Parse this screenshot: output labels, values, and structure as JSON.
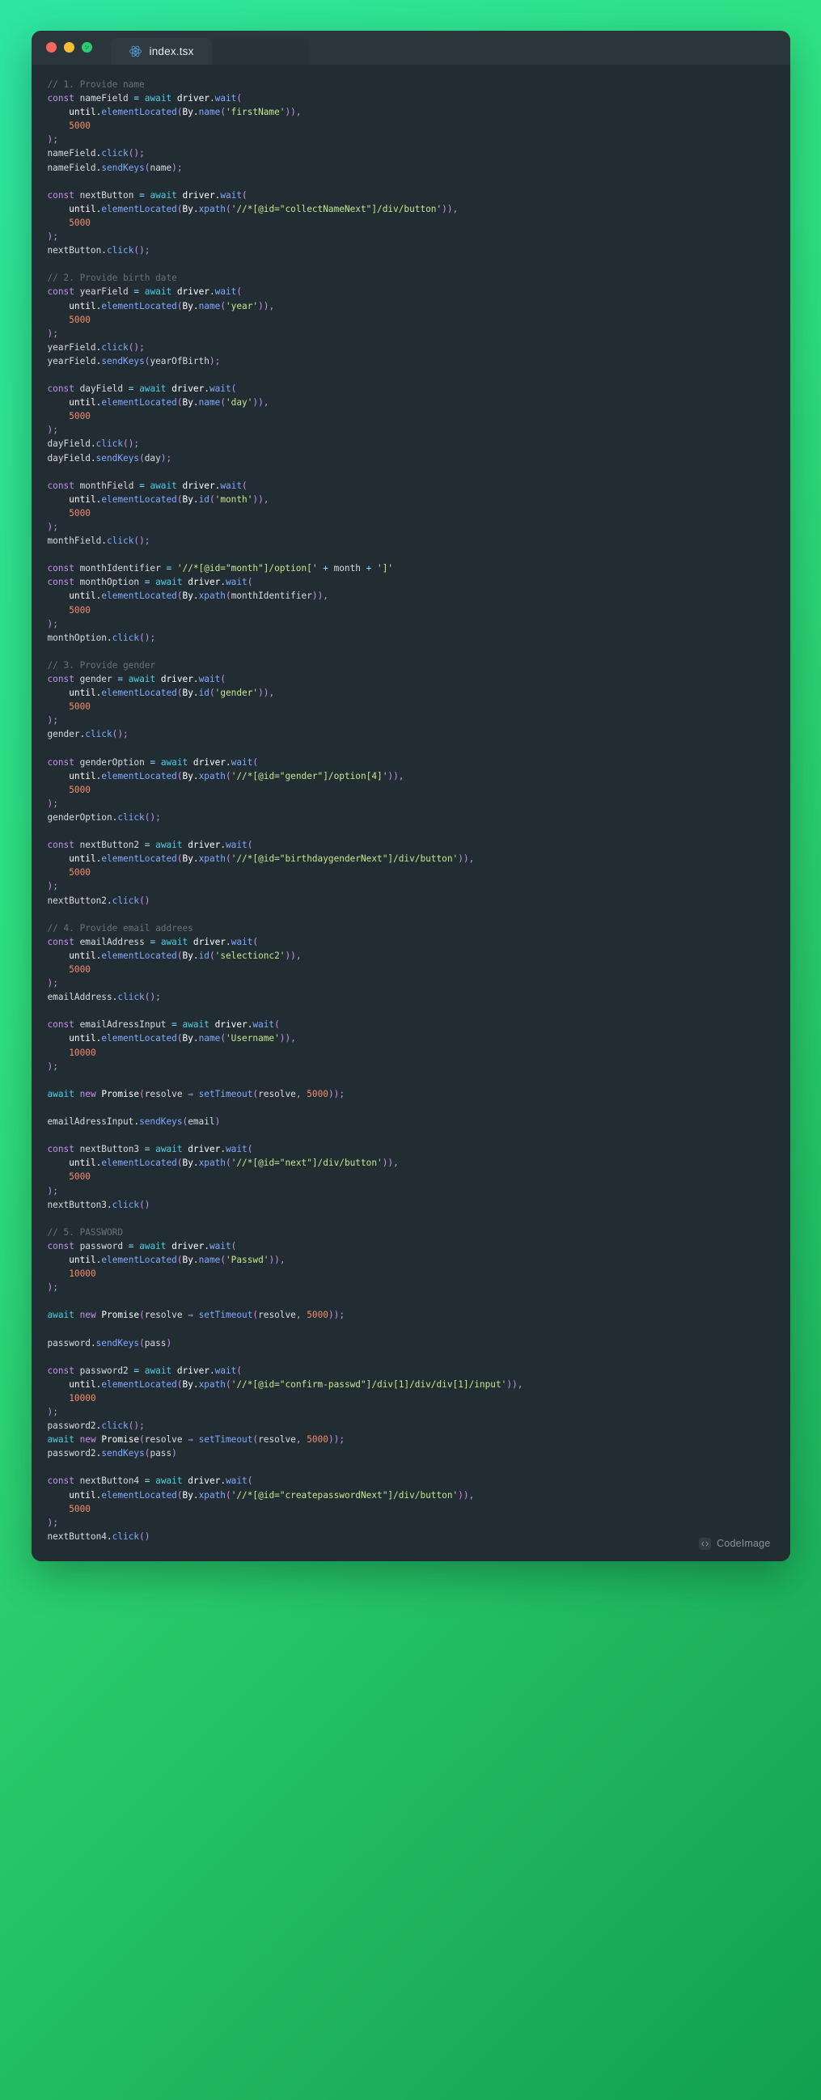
{
  "window": {
    "traffic_lights": [
      {
        "name": "close-button",
        "color": "#f9655f"
      },
      {
        "name": "minimize-button",
        "color": "#f7bd33"
      },
      {
        "name": "maximize-button",
        "color": "#2ecc71"
      }
    ],
    "tab": {
      "icon": "react-icon",
      "label": "index.tsx"
    }
  },
  "watermark": {
    "icon": "codeimage-logo-icon",
    "label": "CodeImage"
  },
  "editor": {
    "language": "typescript",
    "theme_background": "#222c33",
    "colors": {
      "comment": "#67737a",
      "keyword": "#c792ea",
      "await": "#4dd0e1",
      "function": "#82aaff",
      "string": "#c3e88d",
      "number": "#f78c6c",
      "punctuation": "#c792ea",
      "operator": "#89ddff",
      "plain": "#eceff4",
      "background": "#222c33",
      "titlebar": "#2b353c",
      "tab_active": "#2f3a42",
      "gradient_start": "#2ee6a0",
      "gradient_end": "#12a04f"
    },
    "code": "// 1. Provide name\nconst nameField = await driver.wait(\n    until.elementLocated(By.name('firstName')),\n    5000\n);\nnameField.click();\nnameField.sendKeys(name);\n\nconst nextButton = await driver.wait(\n    until.elementLocated(By.xpath('//*[@id=\"collectNameNext\"]/div/button')),\n    5000\n);\nnextButton.click();\n\n// 2. Provide birth date\nconst yearField = await driver.wait(\n    until.elementLocated(By.name('year')),\n    5000\n);\nyearField.click();\nyearField.sendKeys(yearOfBirth);\n\nconst dayField = await driver.wait(\n    until.elementLocated(By.name('day')),\n    5000\n);\ndayField.click();\ndayField.sendKeys(day);\n\nconst monthField = await driver.wait(\n    until.elementLocated(By.id('month')),\n    5000\n);\nmonthField.click();\n\nconst monthIdentifier = '//*[@id=\"month\"]/option[' + month + ']'\nconst monthOption = await driver.wait(\n    until.elementLocated(By.xpath(monthIdentifier)),\n    5000\n);\nmonthOption.click();\n\n// 3. Provide gender\nconst gender = await driver.wait(\n    until.elementLocated(By.id('gender')),\n    5000\n);\ngender.click();\n\nconst genderOption = await driver.wait(\n    until.elementLocated(By.xpath('//*[@id=\"gender\"]/option[4]')),\n    5000\n);\ngenderOption.click();\n\nconst nextButton2 = await driver.wait(\n    until.elementLocated(By.xpath('//*[@id=\"birthdaygenderNext\"]/div/button')),\n    5000\n);\nnextButton2.click()\n\n// 4. Provide email addrees\nconst emailAddress = await driver.wait(\n    until.elementLocated(By.id('selectionc2')),\n    5000\n);\nemailAddress.click();\n\nconst emailAdressInput = await driver.wait(\n    until.elementLocated(By.name('Username')),\n    10000\n);\n\nawait new Promise(resolve => setTimeout(resolve, 5000));\n\nemailAdressInput.sendKeys(email)\n\nconst nextButton3 = await driver.wait(\n    until.elementLocated(By.xpath('//*[@id=\"next\"]/div/button')),\n    5000\n);\nnextButton3.click()\n\n// 5. PASSWORD\nconst password = await driver.wait(\n    until.elementLocated(By.name('Passwd')),\n    10000\n);\n\nawait new Promise(resolve => setTimeout(resolve, 5000));\n\npassword.sendKeys(pass)\n\nconst password2 = await driver.wait(\n    until.elementLocated(By.xpath('//*[@id=\"confirm-passwd\"]/div[1]/div/div[1]/input')),\n    10000\n);\npassword2.click();\nawait new Promise(resolve => setTimeout(resolve, 5000));\npassword2.sendKeys(pass)\n\nconst nextButton4 = await driver.wait(\n    until.elementLocated(By.xpath('//*[@id=\"createpasswordNext\"]/div/button')),\n    5000\n);\nnextButton4.click()"
  }
}
